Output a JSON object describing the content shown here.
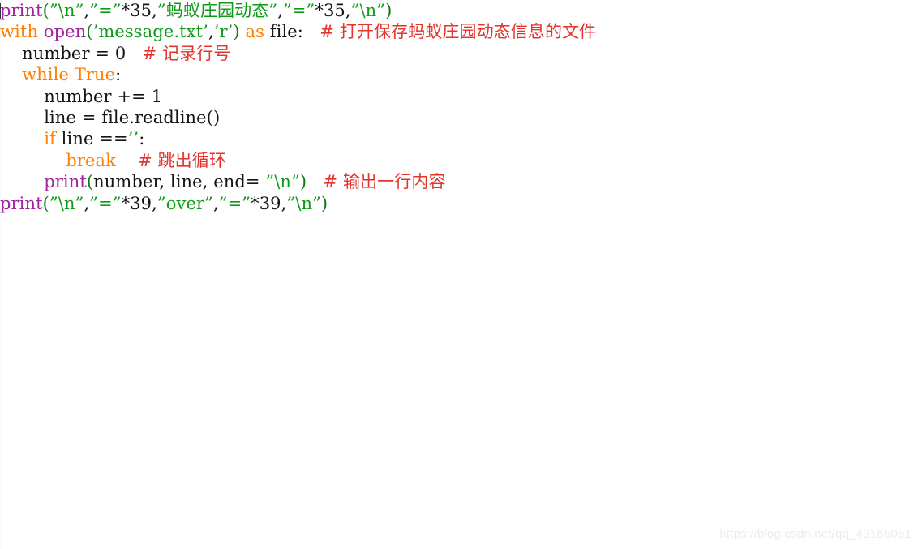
{
  "editor": {
    "background_color": "#ffffff",
    "language": "python",
    "syntax_colors": {
      "default": "#141414",
      "function": "#A0229E",
      "keyword": "#FF8000",
      "string": "#0E9B18",
      "comment": "#E4342B"
    }
  },
  "code": {
    "lines": [
      {
        "id": "line-1",
        "indent": "",
        "tokens": [
          {
            "kind": "caret",
            "text": ""
          },
          {
            "kind": "fn",
            "text": "print"
          },
          {
            "kind": "punct",
            "text": "("
          },
          {
            "kind": "str",
            "text": "”\\n”"
          },
          {
            "kind": "def",
            "text": ","
          },
          {
            "kind": "str",
            "text": "”=”"
          },
          {
            "kind": "def",
            "text": "*35,"
          },
          {
            "kind": "str",
            "text": "”蚂蚁庄园动态”"
          },
          {
            "kind": "def",
            "text": ","
          },
          {
            "kind": "str",
            "text": "”=”"
          },
          {
            "kind": "def",
            "text": "*35,"
          },
          {
            "kind": "str",
            "text": "”\\n”"
          },
          {
            "kind": "punct",
            "text": ")"
          }
        ]
      },
      {
        "id": "line-2",
        "indent": "",
        "tokens": [
          {
            "kind": "kw",
            "text": "with"
          },
          {
            "kind": "def",
            "text": " "
          },
          {
            "kind": "fn",
            "text": "open"
          },
          {
            "kind": "punct",
            "text": "("
          },
          {
            "kind": "str",
            "text": "’message.txt’"
          },
          {
            "kind": "def",
            "text": ","
          },
          {
            "kind": "str",
            "text": "’r’"
          },
          {
            "kind": "punct",
            "text": ")"
          },
          {
            "kind": "def",
            "text": " "
          },
          {
            "kind": "kw",
            "text": "as"
          },
          {
            "kind": "def",
            "text": " file:   "
          },
          {
            "kind": "com",
            "text": "# 打开保存蚂蚁庄园动态信息的文件"
          }
        ]
      },
      {
        "id": "line-3",
        "indent": "    ",
        "tokens": [
          {
            "kind": "def",
            "text": "number = 0   "
          },
          {
            "kind": "com",
            "text": "# 记录行号"
          }
        ]
      },
      {
        "id": "line-4",
        "indent": "    ",
        "tokens": [
          {
            "kind": "kw",
            "text": "while"
          },
          {
            "kind": "def",
            "text": " "
          },
          {
            "kind": "kw",
            "text": "True"
          },
          {
            "kind": "def",
            "text": ":"
          }
        ]
      },
      {
        "id": "line-5",
        "indent": "        ",
        "tokens": [
          {
            "kind": "def",
            "text": "number += 1"
          }
        ]
      },
      {
        "id": "line-6",
        "indent": "        ",
        "tokens": [
          {
            "kind": "def",
            "text": "line = file.readline()"
          }
        ]
      },
      {
        "id": "line-7",
        "indent": "        ",
        "tokens": [
          {
            "kind": "kw",
            "text": "if"
          },
          {
            "kind": "def",
            "text": " line =="
          },
          {
            "kind": "str",
            "text": "’’"
          },
          {
            "kind": "def",
            "text": ":"
          }
        ]
      },
      {
        "id": "line-8",
        "indent": "            ",
        "tokens": [
          {
            "kind": "kw",
            "text": "break"
          },
          {
            "kind": "def",
            "text": "    "
          },
          {
            "kind": "com",
            "text": "# 跳出循环"
          }
        ]
      },
      {
        "id": "line-9",
        "indent": "        ",
        "tokens": [
          {
            "kind": "fn",
            "text": "print"
          },
          {
            "kind": "punct",
            "text": "("
          },
          {
            "kind": "def",
            "text": "number, line, end= "
          },
          {
            "kind": "str",
            "text": "”\\n”"
          },
          {
            "kind": "punct",
            "text": ")"
          },
          {
            "kind": "def",
            "text": "   "
          },
          {
            "kind": "com",
            "text": "# 输出一行内容"
          }
        ]
      },
      {
        "id": "line-10",
        "indent": "",
        "tokens": [
          {
            "kind": "fn",
            "text": "print"
          },
          {
            "kind": "punct",
            "text": "("
          },
          {
            "kind": "str",
            "text": "”\\n”"
          },
          {
            "kind": "def",
            "text": ","
          },
          {
            "kind": "str",
            "text": "”=”"
          },
          {
            "kind": "def",
            "text": "*39,"
          },
          {
            "kind": "str",
            "text": "”over”"
          },
          {
            "kind": "def",
            "text": ","
          },
          {
            "kind": "str",
            "text": "”=”"
          },
          {
            "kind": "def",
            "text": "*39,"
          },
          {
            "kind": "str",
            "text": "”\\n”"
          },
          {
            "kind": "punct",
            "text": ")"
          }
        ]
      }
    ]
  },
  "watermark": {
    "text": "https://blog.csdn.net/qq_43165081",
    "color": "#ECECEC"
  }
}
